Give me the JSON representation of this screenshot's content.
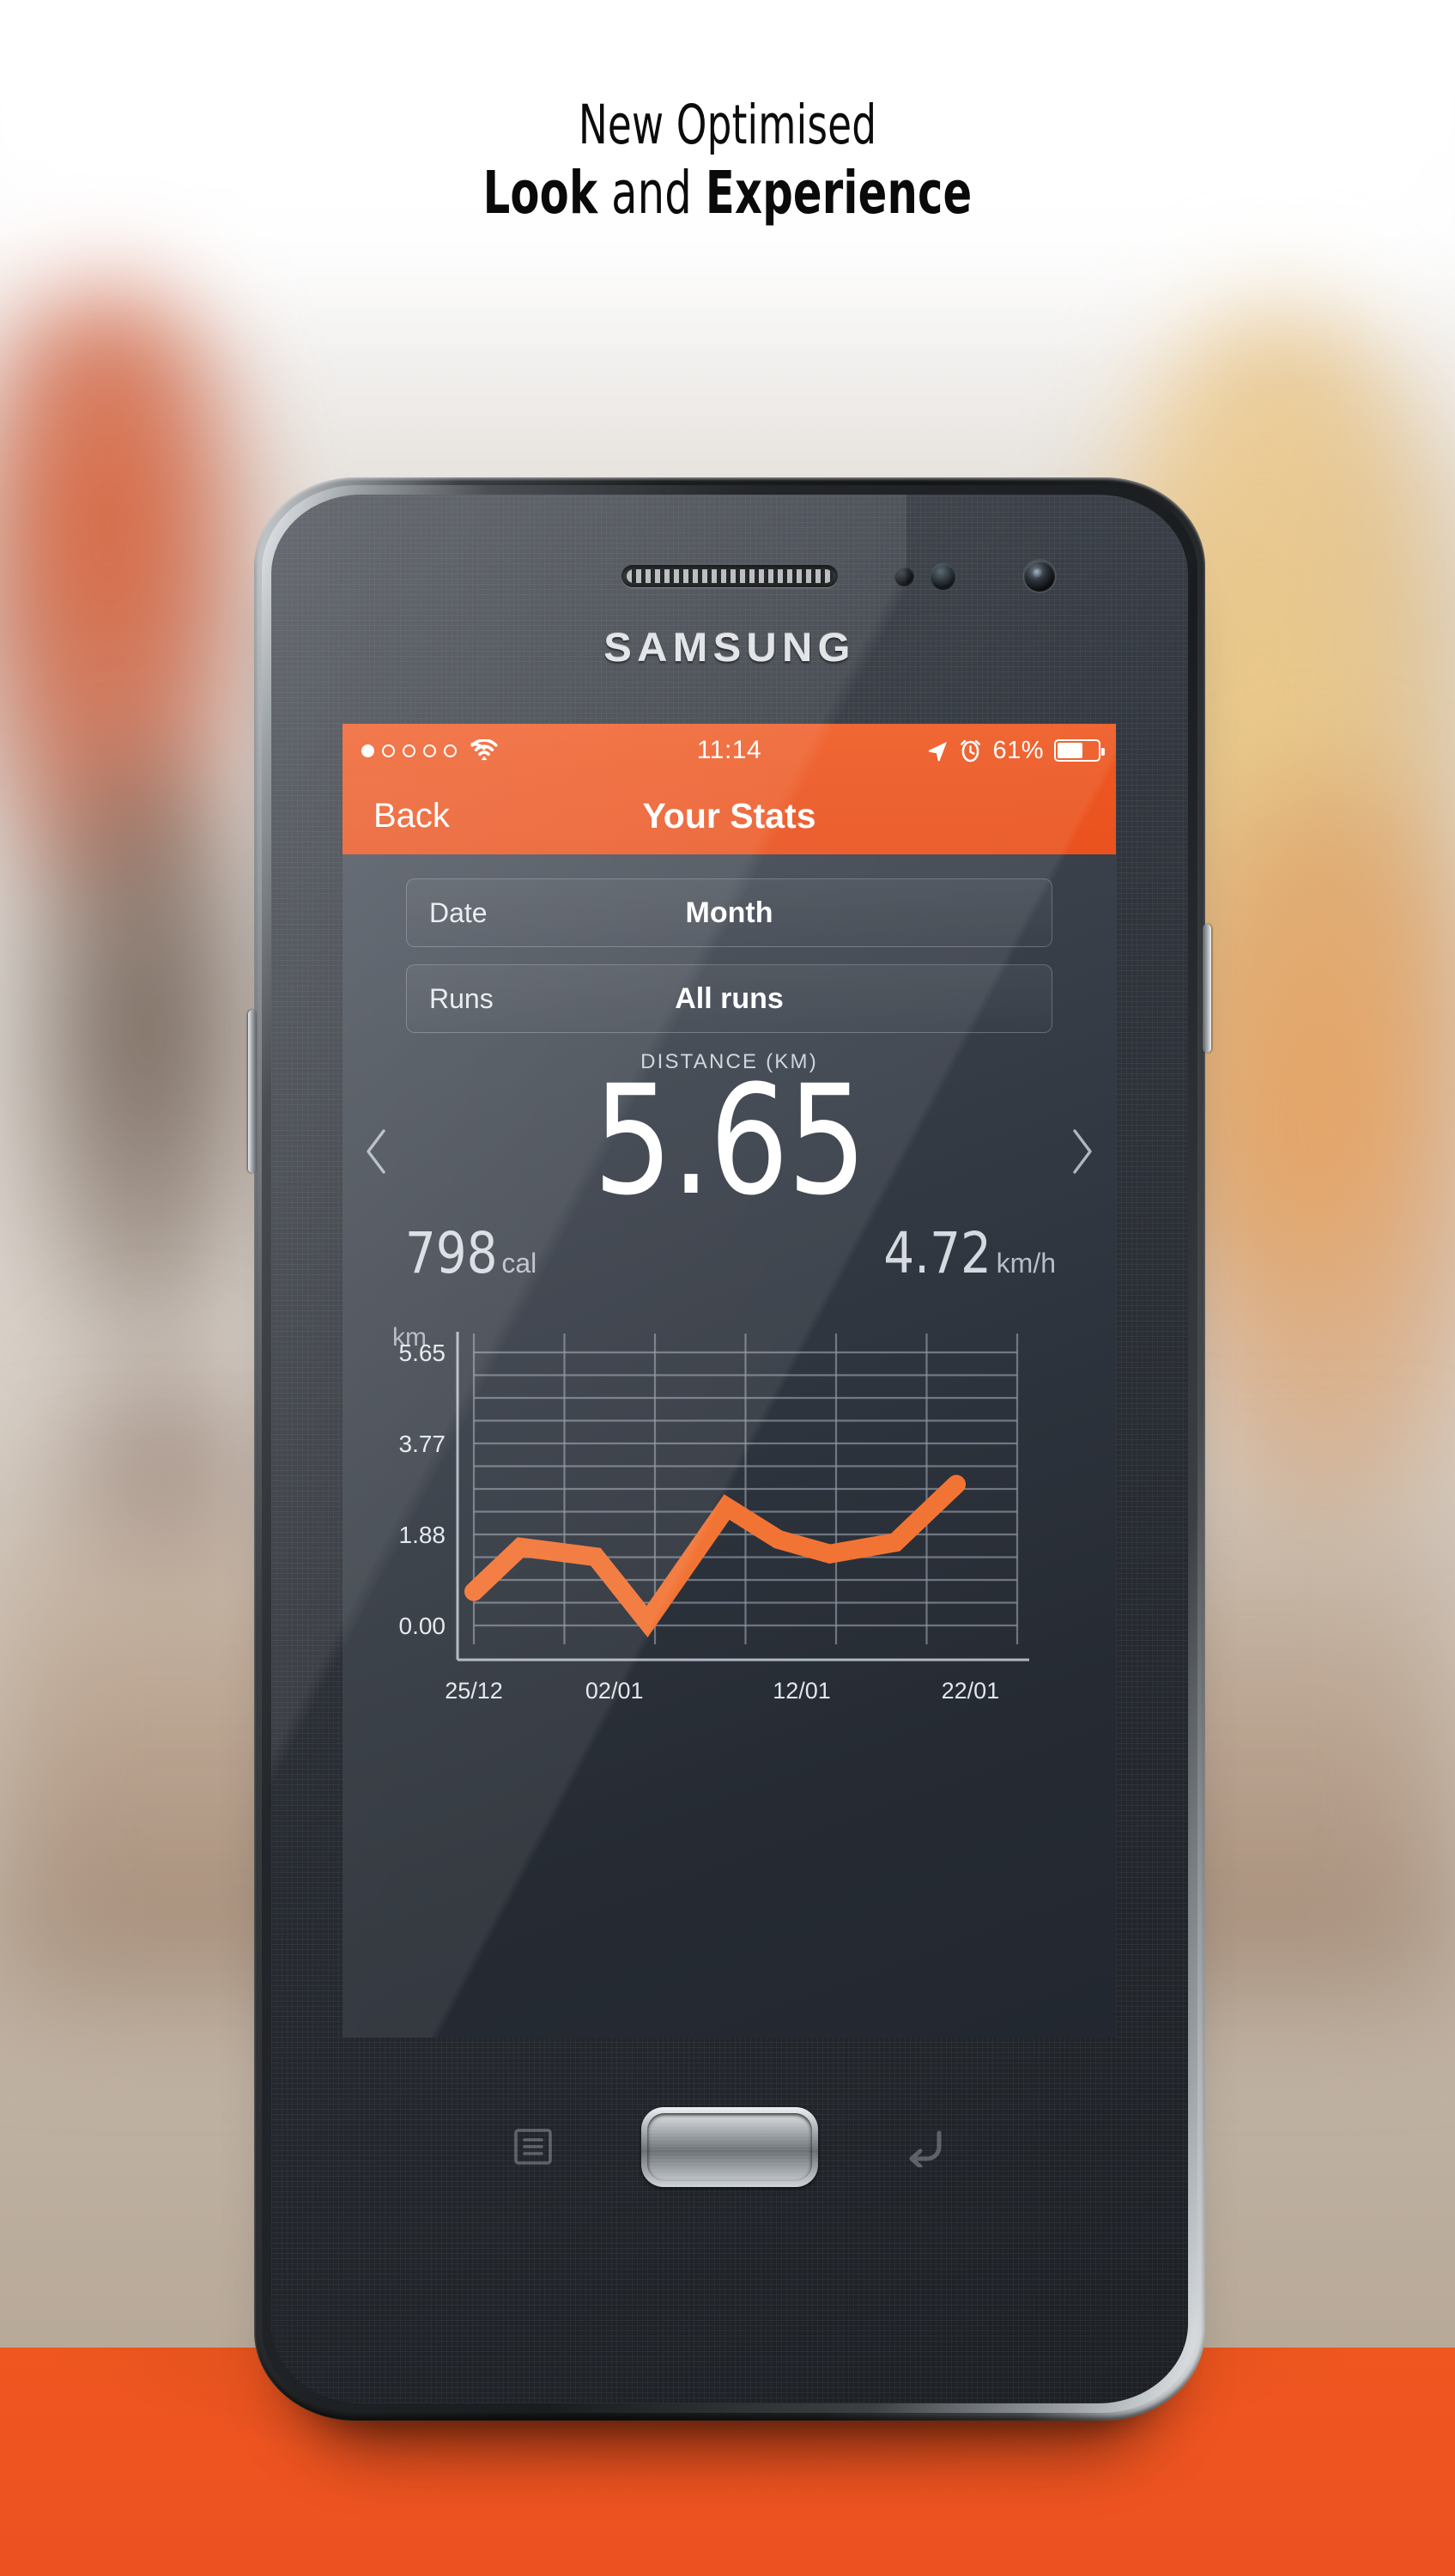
{
  "promo": {
    "headline_line1": "New Optimised",
    "headline_line2_bold1": "Look",
    "headline_line2_plain": " and ",
    "headline_line2_bold2": "Experience"
  },
  "device": {
    "brand": "SAMSUNG",
    "home_button": "home-button",
    "menu_key": "menu-key",
    "back_key": "back-key"
  },
  "status_bar": {
    "signal_dots_total": 5,
    "signal_dots_filled": 1,
    "wifi": "wifi-icon",
    "time": "11:14",
    "location": "location-arrow-icon",
    "alarm": "alarm-clock-icon",
    "battery_percent": "61%",
    "battery": "battery-icon"
  },
  "nav_bar": {
    "back_label": "Back",
    "title": "Your Stats"
  },
  "filters": [
    {
      "label": "Date",
      "value": "Month"
    },
    {
      "label": "Runs",
      "value": "All runs"
    }
  ],
  "primary_stat": {
    "label": "DISTANCE (KM)",
    "value": "5.65",
    "prev_arrow": "chevron-left-icon",
    "next_arrow": "chevron-right-icon"
  },
  "secondary_stats": [
    {
      "value": "798",
      "unit": "cal"
    },
    {
      "value": "4.72",
      "unit": "km/h"
    }
  ],
  "colors": {
    "accent_orange": "#ef5a23",
    "banner_orange": "#ec5221",
    "screen_bg": "#2d333c",
    "chart_line": "#f27435",
    "grid_line": "#8b939f"
  },
  "chart_data": {
    "type": "line",
    "title": "",
    "xlabel": "",
    "ylabel": "km",
    "unit_label": "km",
    "ylim": [
      0.0,
      5.65
    ],
    "ytick_labels": [
      "5.65",
      "3.77",
      "1.88",
      "0.00"
    ],
    "ytick_values": [
      5.65,
      3.77,
      1.88,
      0.0
    ],
    "xtick_labels": [
      "25/12",
      "02/01",
      "12/01",
      "22/01"
    ],
    "xtick_positions": [
      0,
      3,
      7,
      10.6
    ],
    "grid": true,
    "grid_horizontal_lines": 13,
    "grid_vertical_lines": 7,
    "legend": "none",
    "series": [
      {
        "name": "Distance",
        "x": [
          0.0,
          1.0,
          2.6,
          3.7,
          5.4,
          6.5,
          7.6,
          9.0,
          10.3
        ],
        "values": [
          0.7,
          1.62,
          1.42,
          0.08,
          2.45,
          1.78,
          1.48,
          1.72,
          2.92
        ]
      }
    ]
  }
}
